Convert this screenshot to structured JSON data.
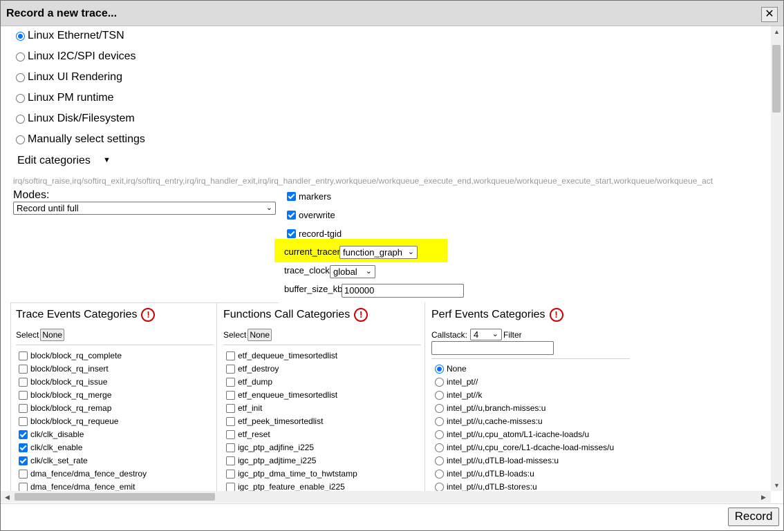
{
  "dialog": {
    "title": "Record a new trace...",
    "close_label": "✕"
  },
  "presets": [
    {
      "label": "Linux Ethernet/TSN",
      "selected": true
    },
    {
      "label": "Linux I2C/SPI devices",
      "selected": false
    },
    {
      "label": "Linux UI Rendering",
      "selected": false
    },
    {
      "label": "Linux PM runtime",
      "selected": false
    },
    {
      "label": "Linux Disk/Filesystem",
      "selected": false
    },
    {
      "label": "Manually select settings",
      "selected": false
    }
  ],
  "edit_categories": {
    "label": "Edit categories",
    "caret": "▼",
    "string": "irq/softirq_raise,irq/softirq_exit,irq/softirq_entry,irq/irq_handler_exit,irq/irq_handler_entry,workqueue/workqueue_execute_end,workqueue/workqueue_execute_start,workqueue/workqueue_act"
  },
  "modes": {
    "label": "Modes:",
    "value": "Record until full"
  },
  "options": {
    "markers": {
      "label": "markers",
      "checked": true
    },
    "overwrite": {
      "label": "overwrite",
      "checked": true
    },
    "record_tgid": {
      "label": "record-tgid",
      "checked": true
    },
    "current_tracer": {
      "label": "current_tracer",
      "value": "function_graph"
    },
    "trace_clock": {
      "label": "trace_clock",
      "value": "global"
    },
    "buffer_size": {
      "label": "buffer_size_kb",
      "value": "100000"
    }
  },
  "trace_events": {
    "title": "Trace Events Categories",
    "select_label": "Select",
    "none_label": "None",
    "items": [
      {
        "label": "block/block_rq_complete",
        "checked": false
      },
      {
        "label": "block/block_rq_insert",
        "checked": false
      },
      {
        "label": "block/block_rq_issue",
        "checked": false
      },
      {
        "label": "block/block_rq_merge",
        "checked": false
      },
      {
        "label": "block/block_rq_remap",
        "checked": false
      },
      {
        "label": "block/block_rq_requeue",
        "checked": false
      },
      {
        "label": "clk/clk_disable",
        "checked": true
      },
      {
        "label": "clk/clk_enable",
        "checked": true
      },
      {
        "label": "clk/clk_set_rate",
        "checked": true
      },
      {
        "label": "dma_fence/dma_fence_destroy",
        "checked": false
      },
      {
        "label": "dma_fence/dma_fence_emit",
        "checked": false
      }
    ]
  },
  "function_calls": {
    "title": "Functions Call Categories",
    "select_label": "Select",
    "none_label": "None",
    "items": [
      {
        "label": "etf_dequeue_timesortedlist",
        "checked": false
      },
      {
        "label": "etf_destroy",
        "checked": false
      },
      {
        "label": "etf_dump",
        "checked": false
      },
      {
        "label": "etf_enqueue_timesortedlist",
        "checked": false
      },
      {
        "label": "etf_init",
        "checked": false
      },
      {
        "label": "etf_peek_timesortedlist",
        "checked": false
      },
      {
        "label": "etf_reset",
        "checked": false
      },
      {
        "label": "igc_ptp_adjfine_i225",
        "checked": false
      },
      {
        "label": "igc_ptp_adjtime_i225",
        "checked": false
      },
      {
        "label": "igc_ptp_dma_time_to_hwtstamp",
        "checked": false
      },
      {
        "label": "igc_ptp_feature_enable_i225",
        "checked": false
      }
    ]
  },
  "perf_events": {
    "title": "Perf Events Categories",
    "callstack_label": "Callstack:",
    "callstack_value": "4",
    "filter_label": "Filter",
    "filter_value": "",
    "items": [
      {
        "label": "None",
        "selected": true
      },
      {
        "label": "intel_pt//",
        "selected": false
      },
      {
        "label": "intel_pt//k",
        "selected": false
      },
      {
        "label": "intel_pt//u,branch-misses:u",
        "selected": false
      },
      {
        "label": "intel_pt//u,cache-misses:u",
        "selected": false
      },
      {
        "label": "intel_pt//u,cpu_atom/L1-icache-loads/u",
        "selected": false
      },
      {
        "label": "intel_pt//u,cpu_core/L1-dcache-load-misses/u",
        "selected": false
      },
      {
        "label": "intel_pt//u,dTLB-load-misses:u",
        "selected": false
      },
      {
        "label": "intel_pt//u,dTLB-loads:u",
        "selected": false
      },
      {
        "label": "intel_pt//u,dTLB-stores:u",
        "selected": false
      }
    ]
  },
  "footer": {
    "record_label": "Record"
  }
}
